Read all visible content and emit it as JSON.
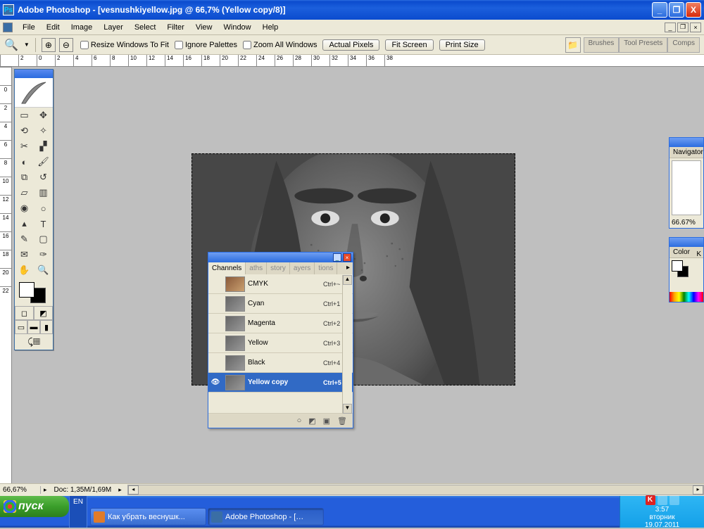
{
  "titlebar": {
    "text": "Adobe Photoshop - [vesnushkiyellow.jpg @ 66,7% (Yellow copy/8)]"
  },
  "menu": [
    "File",
    "Edit",
    "Image",
    "Layer",
    "Select",
    "Filter",
    "View",
    "Window",
    "Help"
  ],
  "optbar": {
    "resize": "Resize Windows To Fit",
    "ignore": "Ignore Palettes",
    "zoomall": "Zoom All Windows",
    "actual": "Actual Pixels",
    "fit": "Fit Screen",
    "print": "Print Size",
    "rtabs": [
      "Brushes",
      "Tool Presets",
      "Comps"
    ]
  },
  "ruler_h": [
    "",
    "2",
    "0",
    "2",
    "4",
    "6",
    "8",
    "10",
    "12",
    "14",
    "16",
    "18",
    "20",
    "22",
    "24",
    "26",
    "28",
    "30",
    "32",
    "34",
    "36",
    "38"
  ],
  "ruler_v": [
    "",
    "0",
    "2",
    "4",
    "6",
    "8",
    "10",
    "12",
    "14",
    "16",
    "18",
    "20",
    "22"
  ],
  "channels": {
    "tabs": [
      "Channels",
      "aths",
      "story",
      "ayers",
      "tions"
    ],
    "rows": [
      {
        "name": "CMYK",
        "shortcut": "Ctrl+~",
        "sel": false,
        "thumb_color": true
      },
      {
        "name": "Cyan",
        "shortcut": "Ctrl+1",
        "sel": false
      },
      {
        "name": "Magenta",
        "shortcut": "Ctrl+2",
        "sel": false
      },
      {
        "name": "Yellow",
        "shortcut": "Ctrl+3",
        "sel": false
      },
      {
        "name": "Black",
        "shortcut": "Ctrl+4",
        "sel": false
      },
      {
        "name": "Yellow copy",
        "shortcut": "Ctrl+5",
        "sel": true
      }
    ]
  },
  "navigator": {
    "title": "Navigator",
    "zoom": "66.67%"
  },
  "colorpal": {
    "title": "Color",
    "label": "K"
  },
  "status": {
    "zoom": "66,67%",
    "doc": "Doc: 1,35M/1,69M"
  },
  "taskbar": {
    "start": "пуск",
    "lang": "EN",
    "tasks": [
      {
        "label": "Как убрать веснушк...",
        "active": false,
        "ico": "#e07b2a"
      },
      {
        "label": "Adobe Photoshop - […",
        "active": true,
        "ico": "#3a6ea5"
      }
    ],
    "time": "3:57",
    "day": "вторник",
    "date": "19.07.2011"
  }
}
